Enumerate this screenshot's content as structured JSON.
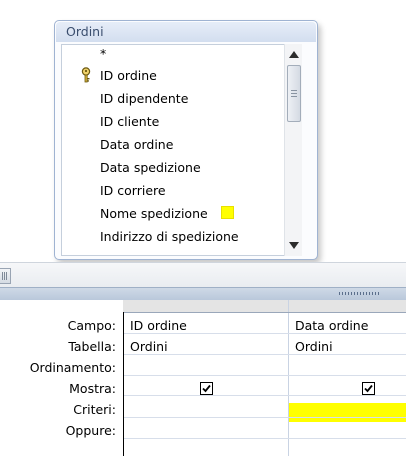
{
  "table": {
    "title": "Ordini",
    "fields": [
      "*",
      "ID ordine",
      "ID dipendente",
      "ID cliente",
      "Data ordine",
      "Data spedizione",
      "ID corriere",
      "Nome spedizione",
      "Indirizzo di spedizione"
    ],
    "primary_key_field": "ID ordine",
    "marked_field": "Nome spedizione"
  },
  "grid": {
    "row_labels": [
      "Campo:",
      "Tabella:",
      "Ordinamento:",
      "Mostra:",
      "Criteri:",
      "Oppure:"
    ],
    "columns": [
      {
        "campo": "ID ordine",
        "tabella": "Ordini",
        "ordinamento": "",
        "mostra": true,
        "criteri": "",
        "oppure": ""
      },
      {
        "campo": "Data ordine",
        "tabella": "Ordini",
        "ordinamento": "",
        "mostra": true,
        "criteri": "",
        "oppure": ""
      }
    ]
  },
  "colors": {
    "highlight": "#ffff00",
    "title_bar": "#d3deef",
    "splitter": "#c3d1e3"
  },
  "icons": {
    "key": "primary-key-icon",
    "scroll_up": "scroll-up-arrow-icon",
    "scroll_down": "scroll-down-arrow-icon",
    "checkbox": "checkbox-checked-icon"
  }
}
